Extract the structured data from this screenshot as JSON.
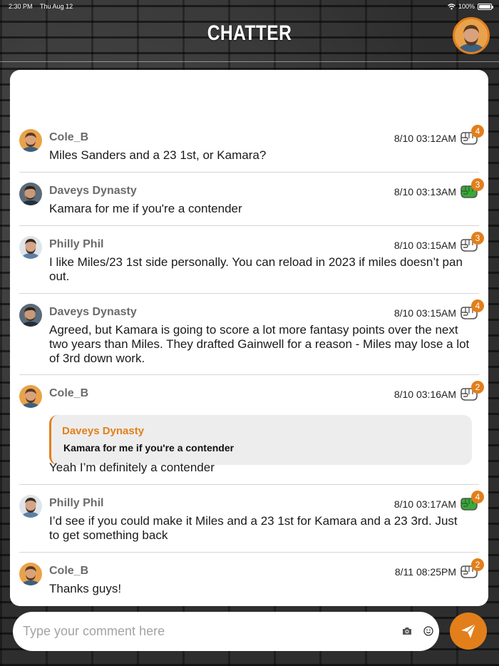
{
  "status_bar": {
    "time": "2:30 PM",
    "date": "Thu Aug 12",
    "battery": "100%"
  },
  "header": {
    "title": "CHATTER",
    "avatar_icon": "profile-avatar"
  },
  "colors": {
    "accent": "#e27f1b",
    "reaction_green": "#3aa83a",
    "username_gray": "#6b6b6b"
  },
  "messages": [
    {
      "user": "Cole_B",
      "time": "8/10 03:12AM",
      "text": "Miles Sanders and a 23 1st, or Kamara?",
      "reactions": "4",
      "reaction_active": false
    },
    {
      "user": "Daveys Dynasty",
      "time": "8/10 03:13AM",
      "text": "Kamara for me if you're a contender",
      "reactions": "3",
      "reaction_active": true
    },
    {
      "user": "Philly Phil",
      "time": "8/10 03:15AM",
      "text": "I like Miles/23 1st side personally. You can reload in 2023 if miles doesn’t pan out.",
      "reactions": "3",
      "reaction_active": false
    },
    {
      "user": "Daveys Dynasty",
      "time": "8/10 03:15AM",
      "text": "Agreed, but Kamara is going to score a lot more fantasy points over the next two years than Miles.  They drafted Gainwell for a reason - Miles may lose a lot of 3rd down work.",
      "reactions": "4",
      "reaction_active": false
    },
    {
      "user": "Cole_B",
      "time": "8/10 03:16AM",
      "text": "Yeah I’m definitely a contender",
      "reactions": "2",
      "reaction_active": false,
      "quote": {
        "user": "Daveys Dynasty",
        "text": "Kamara for me if you're a contender"
      }
    },
    {
      "user": "Philly Phil",
      "time": "8/10 03:17AM",
      "text": "I’d see if you could make it Miles and a 23 1st for Kamara and a 23 3rd. Just to get something back",
      "reactions": "4",
      "reaction_active": true
    },
    {
      "user": "Cole_B",
      "time": "8/11 08:25PM",
      "text": "Thanks guys!",
      "reactions": "2",
      "reaction_active": false
    }
  ],
  "composer": {
    "placeholder": "Type your comment here",
    "camera_icon": "camera-icon",
    "emoji_icon": "emoji-icon",
    "send_icon": "send-icon"
  }
}
